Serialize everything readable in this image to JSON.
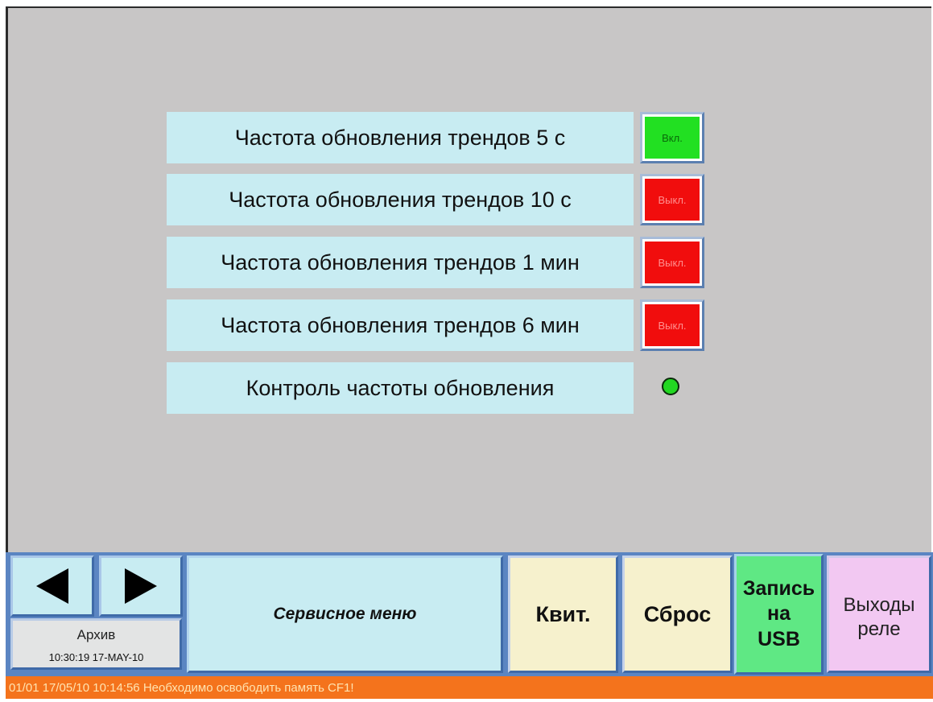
{
  "settings": [
    {
      "label": "Частота обновления трендов 5 с",
      "state": "Вкл."
    },
    {
      "label": "Частота обновления трендов 10 с",
      "state": "Выкл."
    },
    {
      "label": "Частота обновления трендов 1 мин",
      "state": "Выкл."
    },
    {
      "label": "Частота обновления трендов 6 мин",
      "state": "Выкл."
    },
    {
      "label": "Контроль частоты обновления"
    }
  ],
  "toolbar": {
    "archive_label": "Архив",
    "archive_time": "10:30:19 17-MAY-10",
    "service_menu": "Сервисное меню",
    "ack_label": "Квит.",
    "reset_label": "Сброс",
    "usb_line1": "Запись",
    "usb_line2": "на",
    "usb_line3": "USB",
    "relay_line1": "Выходы",
    "relay_line2": "реле"
  },
  "status_message": "01/01 17/05/10 10:14:56 Необходимо освободить память CF1!",
  "colors": {
    "background": "#c8c6c6",
    "label_bg": "#c8ecf2",
    "on": "#22e022",
    "off": "#f10d0d",
    "status_bar": "#f4731c"
  },
  "icons": [
    "arrow-left-icon",
    "arrow-right-icon",
    "status-indicator-icon"
  ]
}
